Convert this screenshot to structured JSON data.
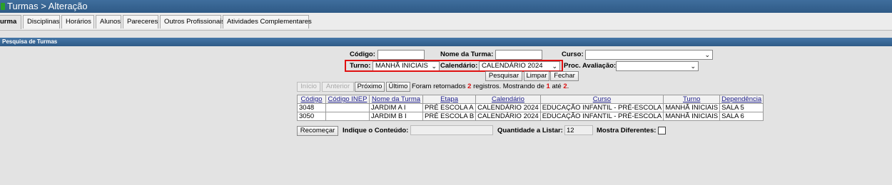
{
  "window": {
    "title": "Turmas > Alteração"
  },
  "tabs": [
    {
      "label": "urma",
      "active": true
    },
    {
      "label": "Disciplinas"
    },
    {
      "label": "Horários"
    },
    {
      "label": "Alunos"
    },
    {
      "label": "Pareceres"
    },
    {
      "label": "Outros Profissionais"
    },
    {
      "label": "Atividades Complementares"
    }
  ],
  "section": {
    "title": "Pesquisa de Turmas"
  },
  "form": {
    "codigo_label": "Código:",
    "codigo_value": "",
    "nome_turma_label": "Nome da Turma:",
    "nome_turma_value": "",
    "curso_label": "Curso:",
    "curso_value": "",
    "turno_label": "Turno:",
    "turno_value": "MANHÃ INICIAIS",
    "calendario_label": "Calendário:",
    "calendario_value": "CALENDÁRIO 2024",
    "proc_avaliacao_label": "Proc. Avaliação:",
    "proc_avaliacao_value": "",
    "pesquisar_label": "Pesquisar",
    "limpar_label": "Limpar",
    "fechar_label": "Fechar"
  },
  "pager": {
    "inicio": "Início",
    "anterior": "Anterior",
    "proximo": "Próximo",
    "ultimo": "Último",
    "msg_part1": "Foram retornados",
    "count": "2",
    "msg_part2": "registros. Mostrando de",
    "from": "1",
    "msg_part3": "até",
    "to": "2",
    "msg_end": "."
  },
  "table": {
    "headers": [
      "Código",
      "Código INEP",
      "Nome da Turma",
      "Etapa",
      "Calendário",
      "Curso",
      "Turno",
      "Dependência"
    ],
    "rows": [
      [
        "3048",
        "",
        "JARDIM A I",
        "PRÉ ESCOLA A",
        "CALENDÁRIO 2024",
        "EDUCAÇÃO INFANTIL - PRÉ-ESCOLA",
        "MANHÃ INICIAIS",
        "SALA 5"
      ],
      [
        "3050",
        "",
        "JARDIM B I",
        "PRÉ ESCOLA B",
        "CALENDÁRIO 2024",
        "EDUCAÇÃO INFANTIL - PRÉ-ESCOLA",
        "MANHÃ INICIAIS",
        "SALA 6"
      ]
    ]
  },
  "bottom": {
    "recomecar_label": "Recomeçar",
    "indique_label": "Indique o Conteúdo:",
    "indique_value": "",
    "quantidade_label": "Quantidade a Listar:",
    "quantidade_value": "12",
    "mostra_label": "Mostra Diferentes:",
    "mostra_checked": false
  },
  "colors": {
    "titlebar": "#2f5a86",
    "highlight": "#e01010",
    "red_text": "#d11"
  }
}
